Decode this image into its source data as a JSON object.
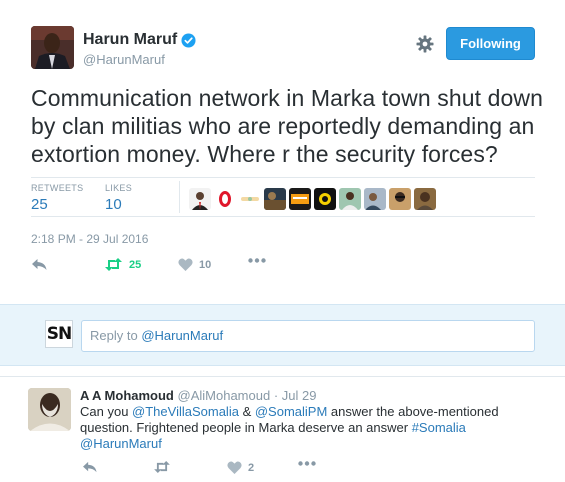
{
  "tweet": {
    "author_name": "Harun Maruf",
    "author_handle": "@HarunMaruf",
    "follow_label": "Following",
    "text": "Communication network in Marka town shut down by clan militias who are reportedly demanding an extortion money. Where r the security forces?",
    "stats": {
      "retweets_label": "RETWEETS",
      "retweets_value": "25",
      "likes_label": "LIKES",
      "likes_value": "10"
    },
    "liker_faces": [
      "face-1",
      "face-2",
      "face-3",
      "face-4",
      "face-5",
      "face-6",
      "face-7",
      "face-8",
      "face-9",
      "face-10"
    ],
    "timestamp": "2:18 PM - 29 Jul 2016",
    "actions": {
      "retweet_count": "25",
      "like_count": "10"
    },
    "icons": [
      "verified-icon",
      "settings-gear-icon",
      "reply-icon",
      "retweet-icon",
      "like-icon",
      "more-icon"
    ]
  },
  "reply_compose": {
    "avatar_text": "SN",
    "prefix": "Reply to ",
    "mention": "@HarunMaruf"
  },
  "reply_tweet": {
    "author_name": "A A Mohamoud",
    "author_handle": "@AliMohamoud",
    "separator": " · ",
    "date": "Jul 29",
    "text_parts": {
      "p1": "Can you ",
      "m1": "@TheVillaSomalia",
      "p2": " & ",
      "m2": "@SomaliPM",
      "p3": " answer the above-mentioned question. Frightened people in Marka deserve an answer ",
      "hashtag": "#Somalia",
      "m3": "@HarunMaruf"
    },
    "like_count": "2"
  },
  "colors": {
    "accent": "#2b9ae0",
    "link": "#2b7bb9",
    "retweet_green": "#19cf86",
    "muted": "#8899a6",
    "reply_bg": "#e8f4fb"
  }
}
